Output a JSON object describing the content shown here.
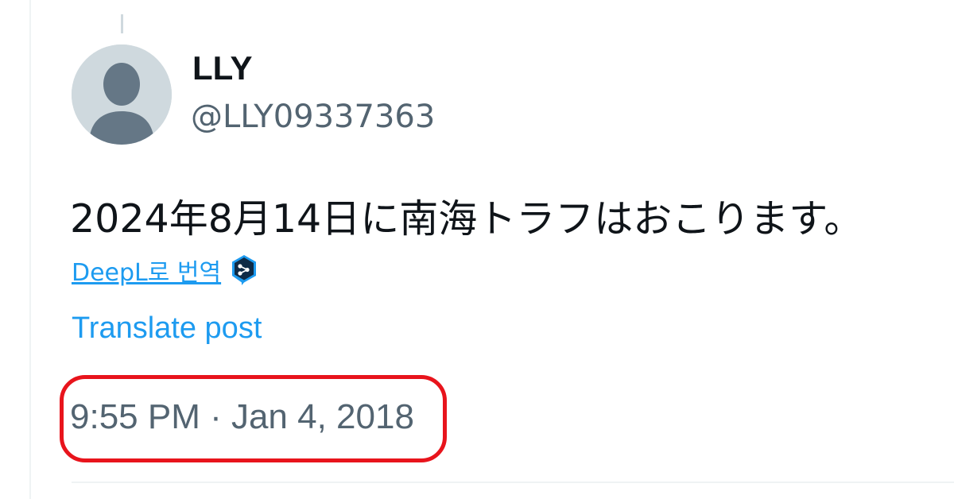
{
  "post": {
    "display_name": "LLY",
    "handle": "@LLY09337363",
    "avatar_icon": "default-profile-avatar-icon",
    "text": "2024年8月14日に南海トラフはおこります。",
    "deepl_label": "DeepL로 번역",
    "deepl_icon": "deepl-logo-icon",
    "translate_label": "Translate post",
    "timestamp": "9:55 PM · Jan 4, 2018"
  },
  "colors": {
    "link": "#1d9bf0",
    "secondary_text": "#536471",
    "highlight_box": "#e8141c",
    "deepl_icon": "#0f2b46"
  }
}
